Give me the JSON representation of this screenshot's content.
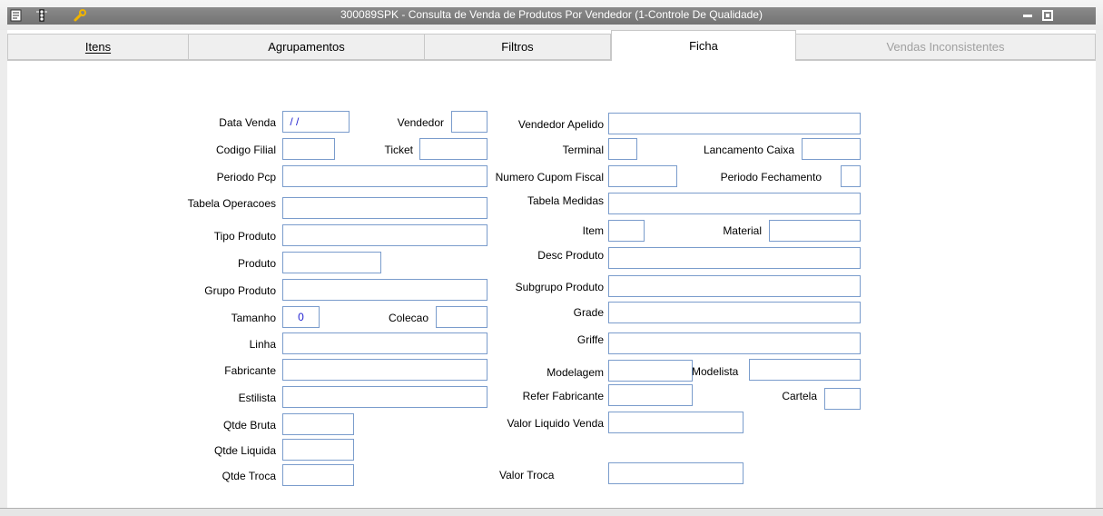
{
  "window": {
    "title": "300089SPK - Consulta de Venda de Produtos Por Vendedor (1-Controle De Qualidade)"
  },
  "toolbar_icons": [
    "list-icon",
    "traffic-light-icon",
    "tools-icon"
  ],
  "tabs": [
    {
      "label": "Itens",
      "state": "normal"
    },
    {
      "label": "Agrupamentos",
      "state": "normal"
    },
    {
      "label": "Filtros",
      "state": "normal"
    },
    {
      "label": "Ficha",
      "state": "active"
    },
    {
      "label": "Vendas Inconsistentes",
      "state": "disabled"
    }
  ],
  "form": {
    "data_venda": {
      "label": "Data Venda",
      "value": " / /"
    },
    "vendedor": {
      "label": "Vendedor",
      "value": ""
    },
    "vendedor_apelido": {
      "label": "Vendedor Apelido",
      "value": ""
    },
    "codigo_filial": {
      "label": "Codigo Filial",
      "value": ""
    },
    "ticket": {
      "label": "Ticket",
      "value": ""
    },
    "terminal": {
      "label": "Terminal",
      "value": ""
    },
    "lancamento_caixa": {
      "label": "Lancamento Caixa",
      "value": ""
    },
    "periodo_pcp": {
      "label": "Periodo Pcp",
      "value": ""
    },
    "numero_cupom_fiscal": {
      "label": "Numero Cupom Fiscal",
      "value": ""
    },
    "periodo_fechamento": {
      "label": "Periodo Fechamento",
      "value": ""
    },
    "tabela_operacoes": {
      "label": "Tabela Operacoes",
      "value": ""
    },
    "tabela_medidas": {
      "label": "Tabela Medidas",
      "value": ""
    },
    "tipo_produto": {
      "label": "Tipo Produto",
      "value": ""
    },
    "item": {
      "label": "Item",
      "value": ""
    },
    "material": {
      "label": "Material",
      "value": ""
    },
    "produto": {
      "label": "Produto",
      "value": ""
    },
    "desc_produto": {
      "label": "Desc Produto",
      "value": ""
    },
    "grupo_produto": {
      "label": "Grupo Produto",
      "value": ""
    },
    "subgrupo_produto": {
      "label": "Subgrupo Produto",
      "value": ""
    },
    "tamanho": {
      "label": "Tamanho",
      "value": "0"
    },
    "colecao": {
      "label": "Colecao",
      "value": ""
    },
    "grade": {
      "label": "Grade",
      "value": ""
    },
    "linha": {
      "label": "Linha",
      "value": ""
    },
    "griffe": {
      "label": "Griffe",
      "value": ""
    },
    "fabricante": {
      "label": "Fabricante",
      "value": ""
    },
    "modelagem": {
      "label": "Modelagem",
      "value": ""
    },
    "modelista": {
      "label": "Modelista",
      "value": ""
    },
    "estilista": {
      "label": "Estilista",
      "value": ""
    },
    "refer_fabricante": {
      "label": "Refer Fabricante",
      "value": ""
    },
    "cartela": {
      "label": "Cartela",
      "value": ""
    },
    "qtde_bruta": {
      "label": "Qtde Bruta",
      "value": ""
    },
    "valor_liquido_venda": {
      "label": "Valor Liquido Venda",
      "value": ""
    },
    "qtde_liquida": {
      "label": "Qtde Liquida",
      "value": ""
    },
    "qtde_troca": {
      "label": "Qtde Troca",
      "value": ""
    },
    "valor_troca": {
      "label": "Valor Troca",
      "value": ""
    }
  }
}
